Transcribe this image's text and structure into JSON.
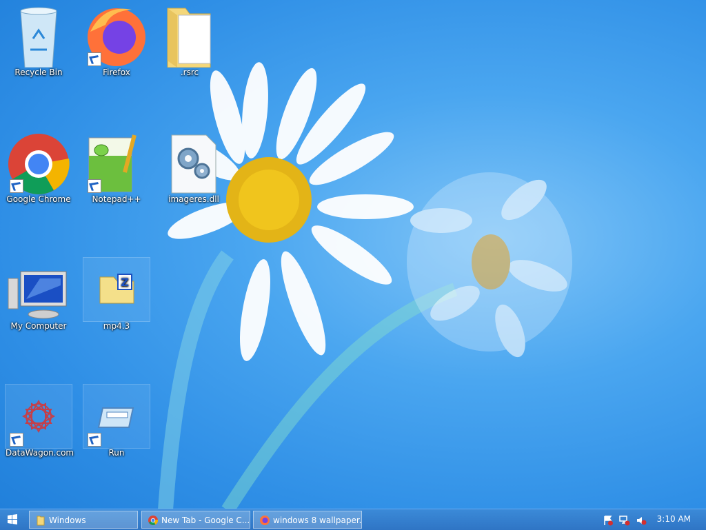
{
  "desktop": {
    "icons": [
      {
        "label": "Recycle Bin",
        "icon": "recycle-bin-icon"
      },
      {
        "label": "Firefox",
        "icon": "firefox-icon"
      },
      {
        "label": ".rsrc",
        "icon": "folder-icon"
      },
      {
        "label": "Google Chrome",
        "icon": "chrome-icon"
      },
      {
        "label": "Notepad++",
        "icon": "notepadpp-icon"
      },
      {
        "label": "imageres.dll",
        "icon": "dll-file-icon"
      },
      {
        "label": "My Computer",
        "icon": "computer-icon"
      },
      {
        "label": "mp4.3",
        "icon": "zip-folder-icon"
      },
      {
        "label": "DataWagon.com",
        "icon": "datawagon-icon"
      },
      {
        "label": "Run",
        "icon": "run-icon"
      }
    ]
  },
  "taskbar": {
    "tasks": [
      {
        "label": "Windows",
        "icon": "folder-icon"
      },
      {
        "label": "New Tab - Google C...",
        "icon": "chrome-icon"
      },
      {
        "label": "windows 8 wallpaper...",
        "icon": "firefox-icon"
      }
    ],
    "clock": "3:10 AM"
  }
}
